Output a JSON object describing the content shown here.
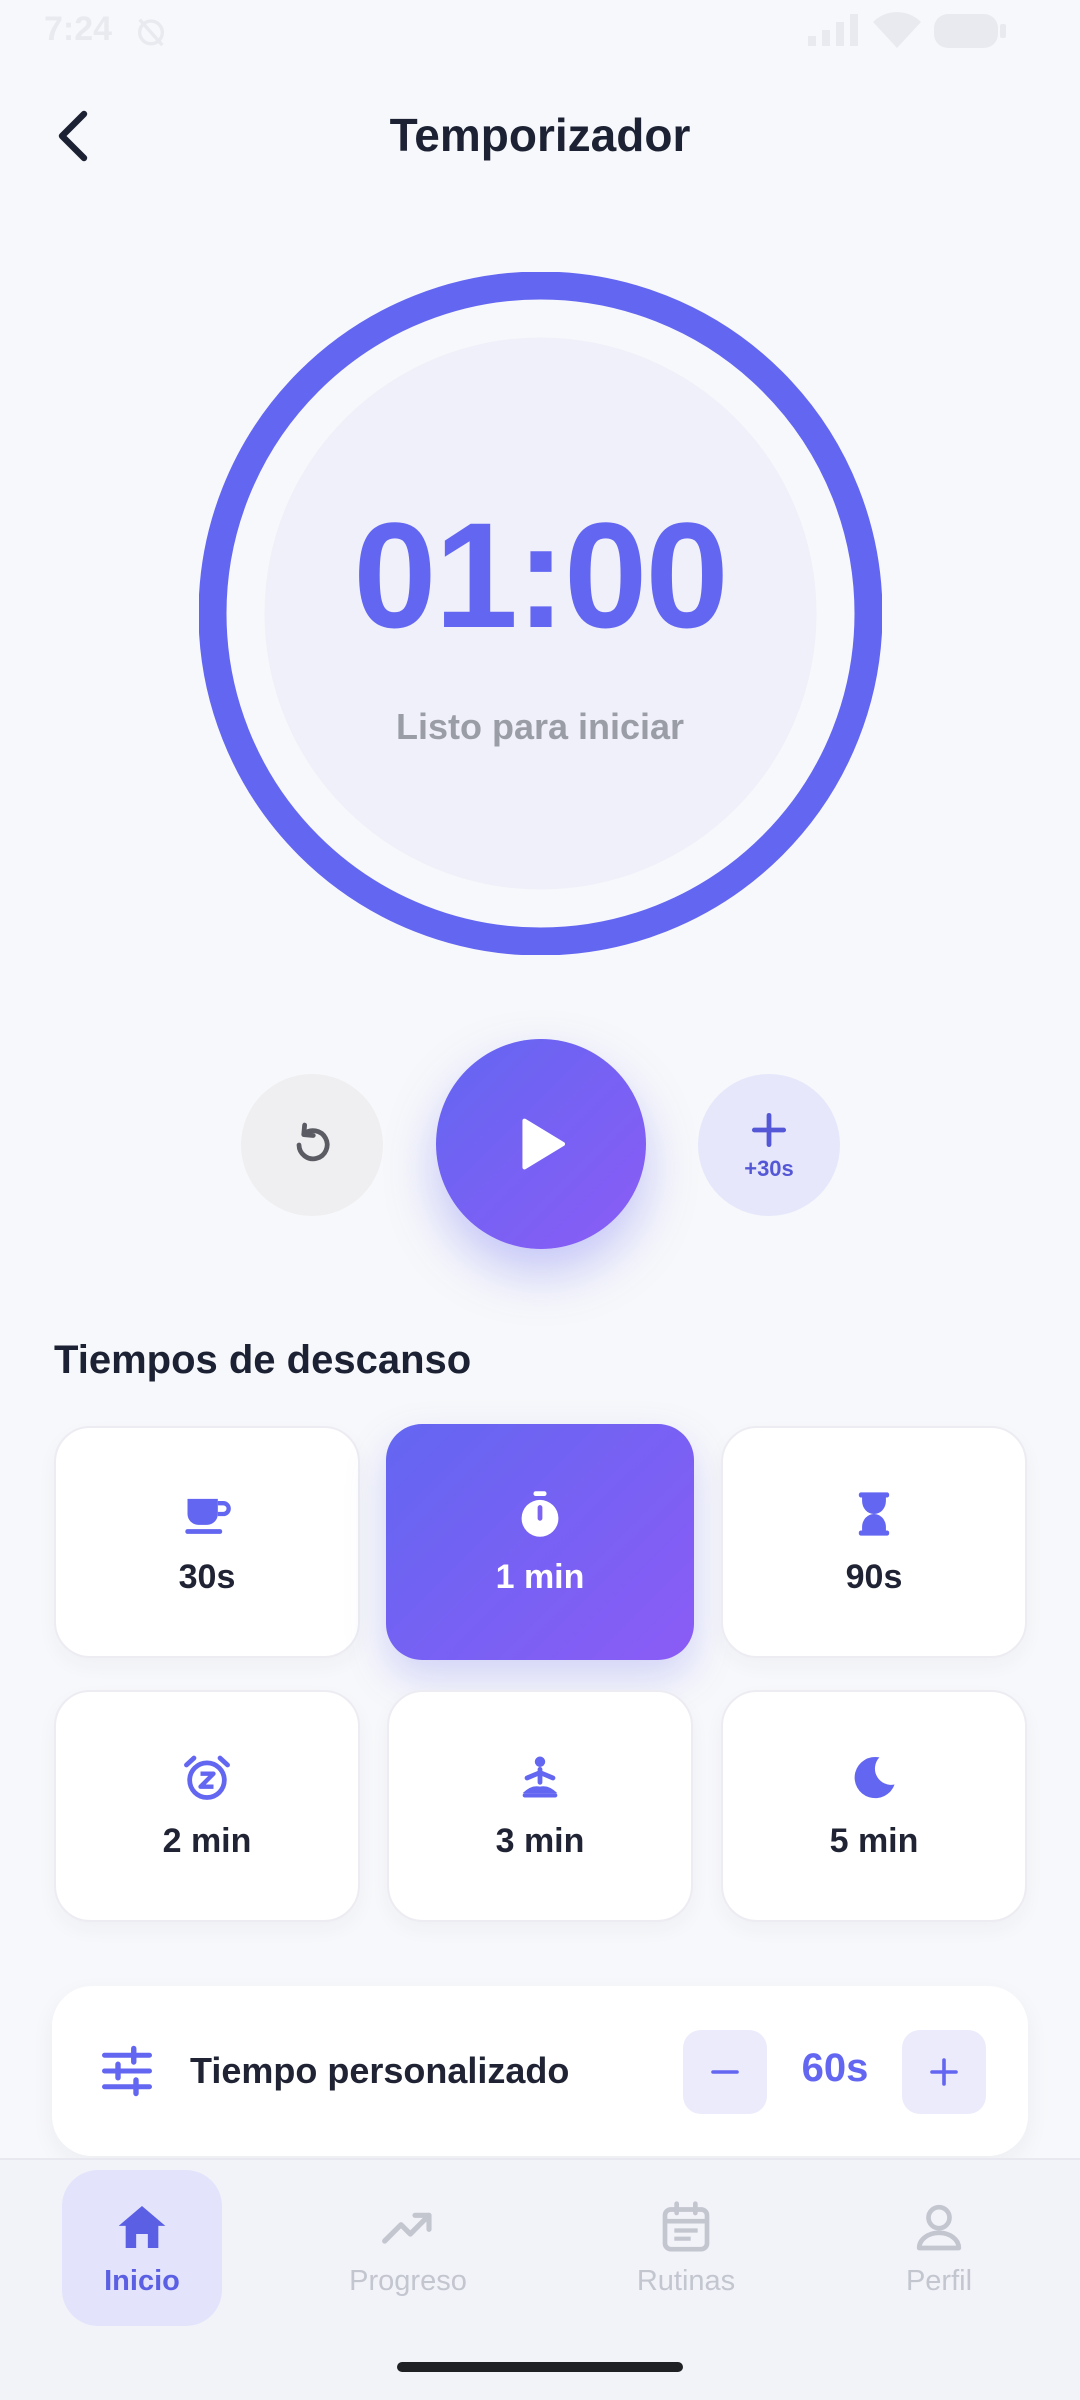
{
  "status_bar": {
    "time": "7:24"
  },
  "header": {
    "title": "Temporizador"
  },
  "timer": {
    "time": "01:00",
    "status": "Listo para iniciar",
    "progress": 1.0
  },
  "controls": {
    "add30_label": "+30s"
  },
  "presets": {
    "title": "Tiempos de descanso",
    "items": [
      {
        "label": "30s",
        "icon": "coffee-icon",
        "active": false
      },
      {
        "label": "1 min",
        "icon": "stopwatch-icon",
        "active": true
      },
      {
        "label": "90s",
        "icon": "hourglass-icon",
        "active": false
      },
      {
        "label": "2 min",
        "icon": "alarm-snooze-icon",
        "active": false
      },
      {
        "label": "3 min",
        "icon": "meditation-icon",
        "active": false
      },
      {
        "label": "5 min",
        "icon": "moon-icon",
        "active": false
      }
    ]
  },
  "custom": {
    "label": "Tiempo personalizado",
    "value": "60s",
    "icon": "sliders-icon"
  },
  "nav": {
    "items": [
      {
        "label": "Inicio",
        "icon": "home-icon",
        "active": true
      },
      {
        "label": "Progreso",
        "icon": "trending-up-icon",
        "active": false
      },
      {
        "label": "Rutinas",
        "icon": "calendar-icon",
        "active": false
      },
      {
        "label": "Perfil",
        "icon": "person-icon",
        "active": false
      }
    ]
  },
  "colors": {
    "accent": "#6366f1",
    "accent2": "#8b5cf6",
    "background": "#f7f8fb"
  }
}
